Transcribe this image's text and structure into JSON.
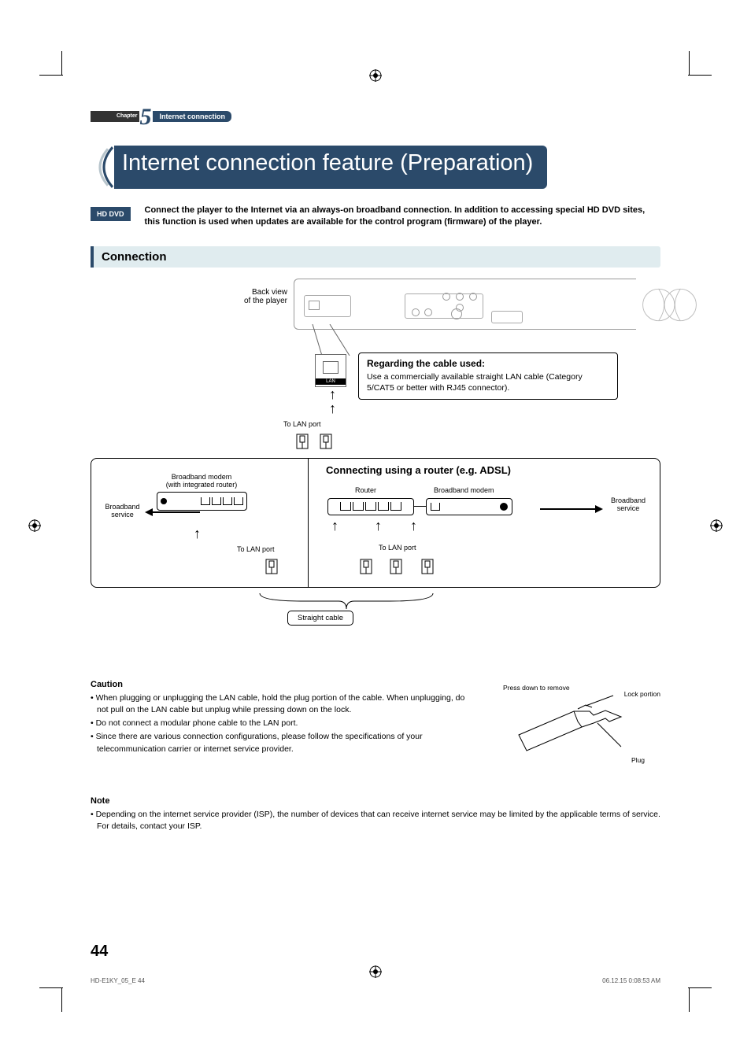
{
  "chapter": {
    "word": "Chapter",
    "num": "5",
    "section": "Internet connection"
  },
  "title": "Internet connection feature (Preparation)",
  "hd_badge": "HD DVD",
  "intro": "Connect the player to the Internet via an always-on broadband connection. In addition to accessing special HD DVD sites, this function is used when updates are available for the control program (firmware) of the player.",
  "section_bar": "Connection",
  "diagram": {
    "back_view": "Back view\nof the player",
    "lan_zoom_label": "LAN",
    "regarding": {
      "heading": "Regarding the cable used:",
      "body": "Use a commercially available straight LAN cable (Category 5/CAT5 or better with RJ45 connector)."
    },
    "to_lan_port": "To LAN port",
    "modem_integrated": "Broadband modem\n(with integrated router)",
    "broadband_service": "Broadband\nservice",
    "router_title": "Connecting using a router (e.g. ADSL)",
    "router": "Router",
    "broadband_modem": "Broadband modem",
    "straight_cable": "Straight cable"
  },
  "caution": {
    "heading": "Caution",
    "items": [
      "When plugging or unplugging the LAN cable, hold the plug portion of the cable. When unplugging, do not pull on the LAN cable but unplug while pressing down on the lock.",
      "Do not connect a modular phone cable to the LAN port.",
      "Since there are various connection configurations, please follow the specifications of your telecommunication carrier or internet service provider."
    ],
    "press_down": "Press down to remove",
    "lock_portion": "Lock portion",
    "plug": "Plug"
  },
  "note": {
    "heading": "Note",
    "body": "Depending on the internet service provider (ISP), the number of devices that can receive internet service may be limited by the applicable terms of service. For details, contact your ISP."
  },
  "page_number": "44",
  "footer_left": "HD-E1KY_05_E   44",
  "footer_right": "06.12.15   0:08:53 AM"
}
